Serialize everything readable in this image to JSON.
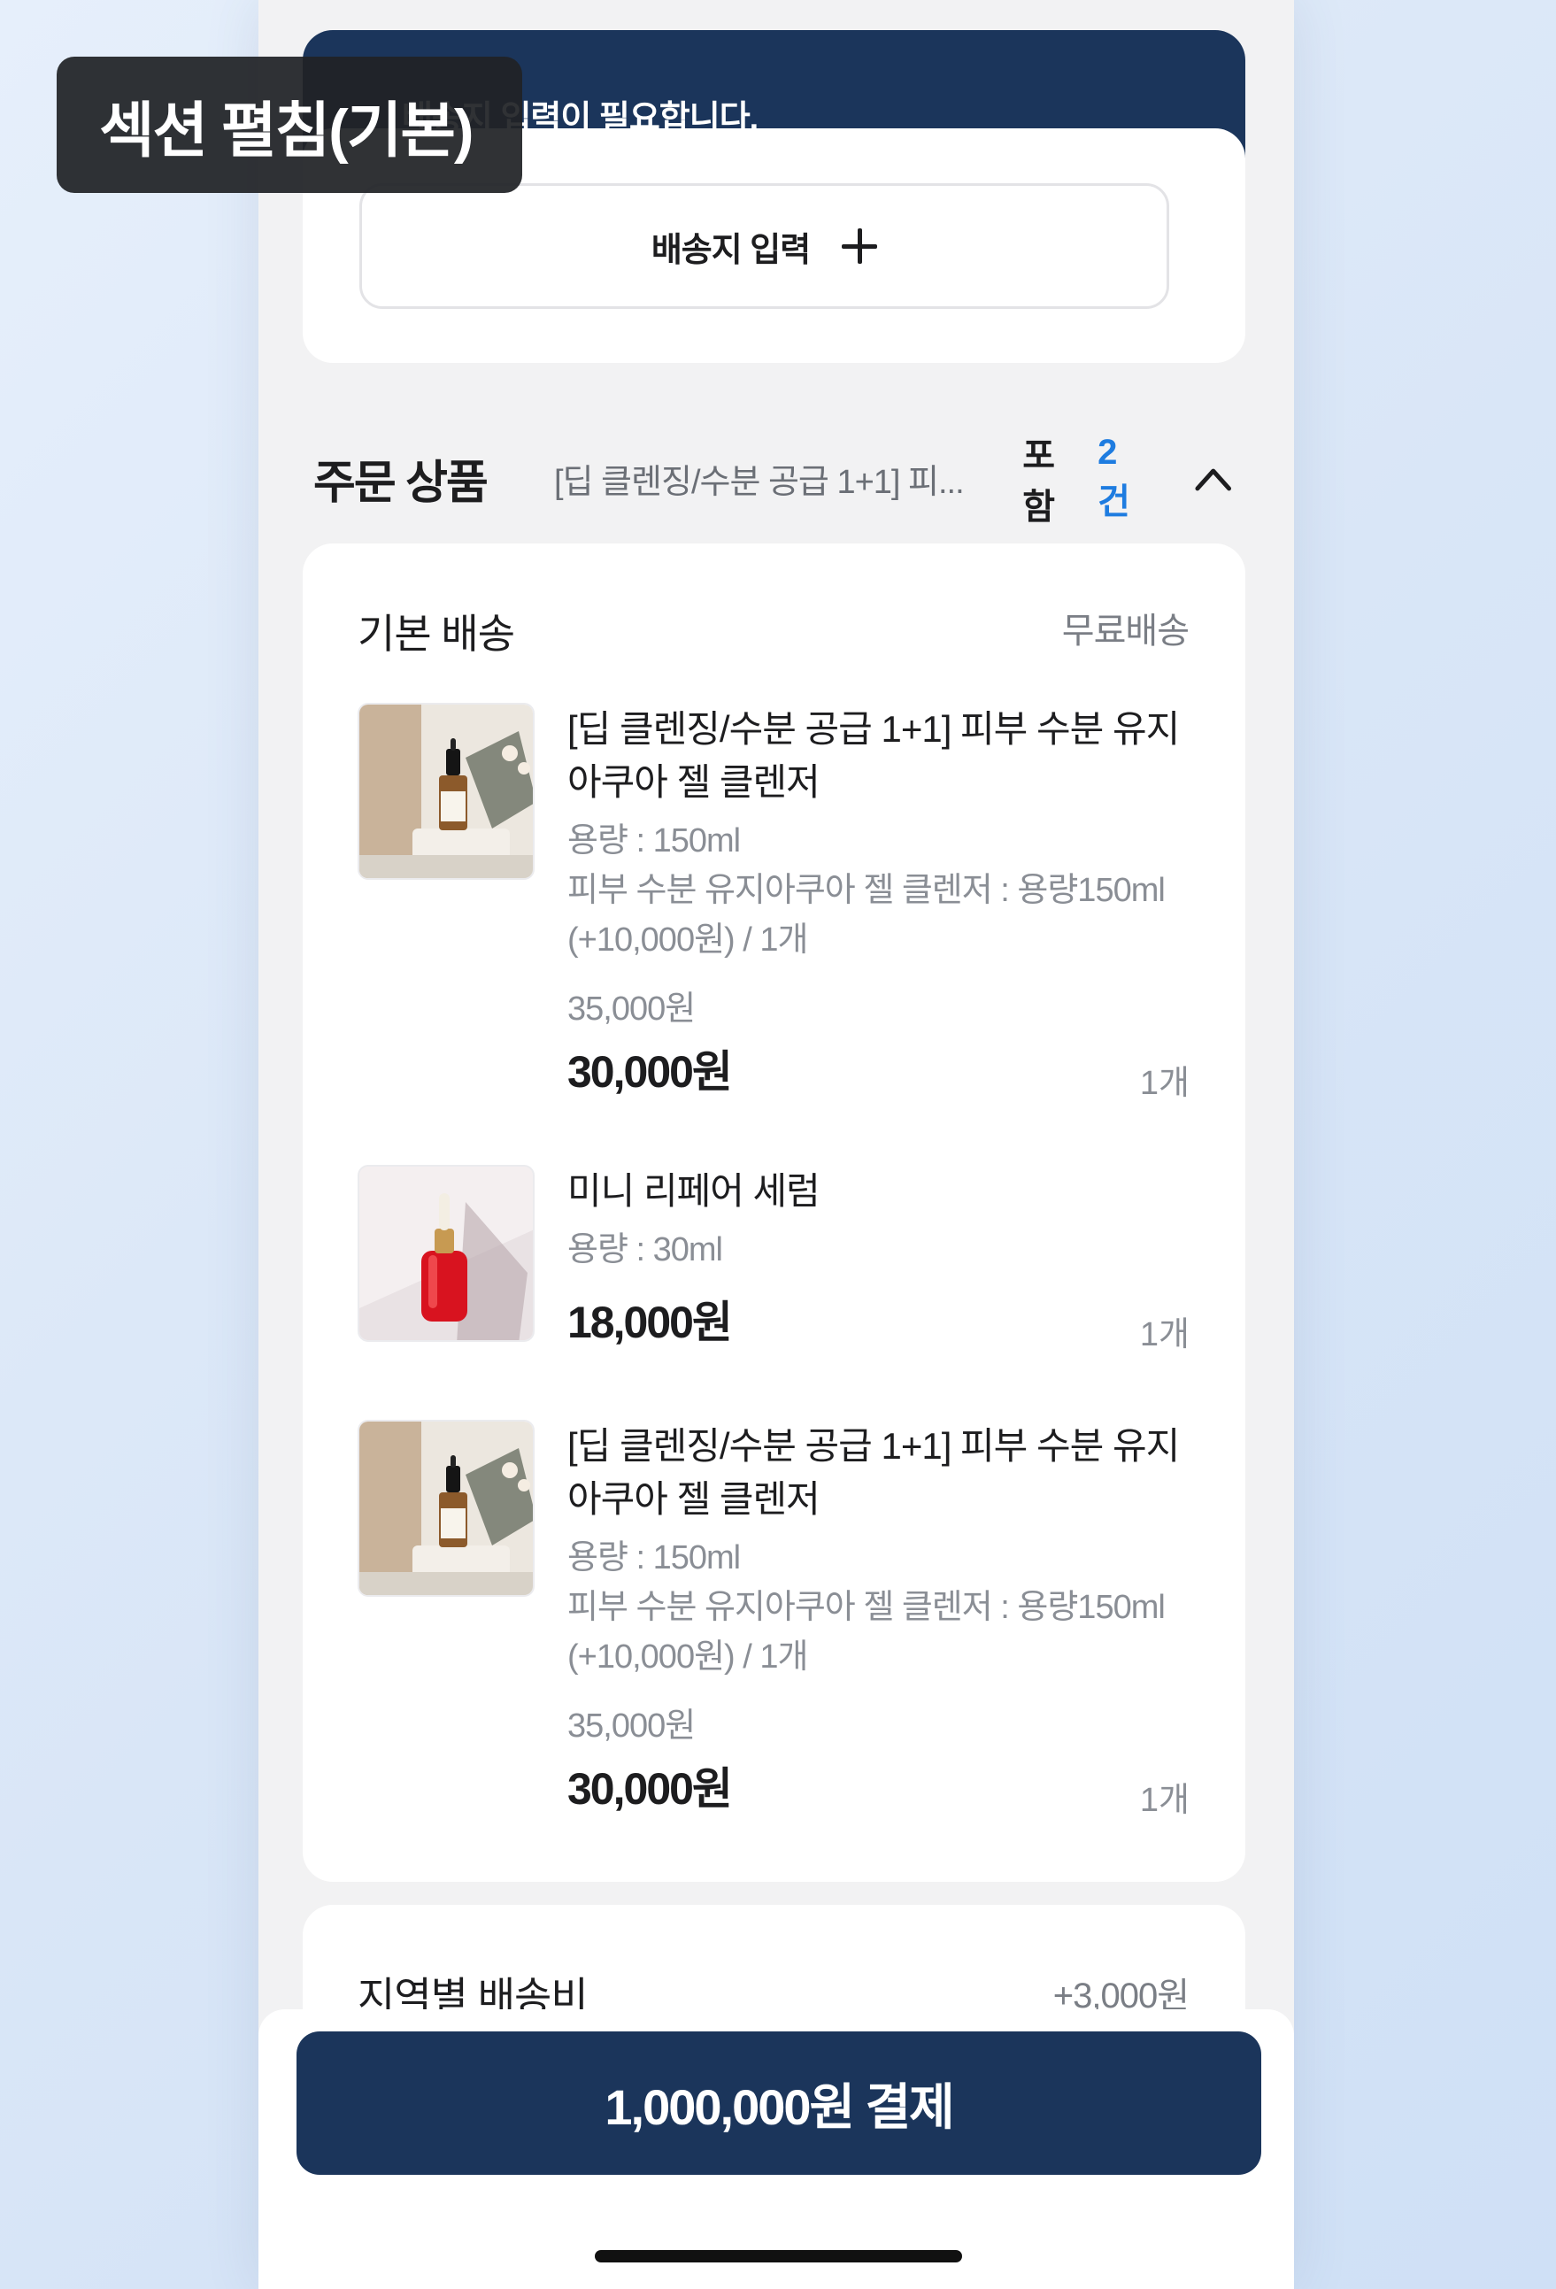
{
  "annotation": {
    "label": "섹션 펼침(기본)"
  },
  "notice": {
    "text": "배송지 입력이 필요합니다."
  },
  "address": {
    "button_label": "배송지 입력"
  },
  "order_header": {
    "title": "주문 상품",
    "summary": "[딥 클렌징/수분 공급 1+1] 피...",
    "include_label": "포함",
    "count": "2건"
  },
  "shipping_group": {
    "title": "기본 배송",
    "fee_label": "무료배송",
    "items": [
      {
        "name": "[딥 클렌징/수분 공급 1+1] 피부 수분 유지 아쿠아 젤 클렌저",
        "options": [
          "용량 : 150ml",
          "피부 수분 유지아쿠아 젤 클렌저 : 용량150ml (+10,000원) / 1개"
        ],
        "original_price": "35,000원",
        "price": "30,000원",
        "quantity": "1개",
        "image": "dropper-bottle-product-photo"
      },
      {
        "name": "미니 리페어 세럼",
        "options": [
          "용량 : 30ml"
        ],
        "original_price": "",
        "price": "18,000원",
        "quantity": "1개",
        "image": "red-serum-bottle-photo"
      },
      {
        "name": "[딥 클렌징/수분 공급 1+1] 피부 수분 유지 아쿠아 젤 클렌저",
        "options": [
          "용량 : 150ml",
          "피부 수분 유지아쿠아 젤 클렌저 : 용량150ml (+10,000원) / 1개"
        ],
        "original_price": "35,000원",
        "price": "30,000원",
        "quantity": "1개",
        "image": "dropper-bottle-product-photo"
      }
    ]
  },
  "region_fee": {
    "title": "지역별 배송비",
    "amount": "+3,000원"
  },
  "payment": {
    "button_label": "1,000,000원 결제"
  },
  "colors": {
    "navy": "#1b355b",
    "accent_blue": "#1e7ce0",
    "muted": "#8a8e95"
  }
}
